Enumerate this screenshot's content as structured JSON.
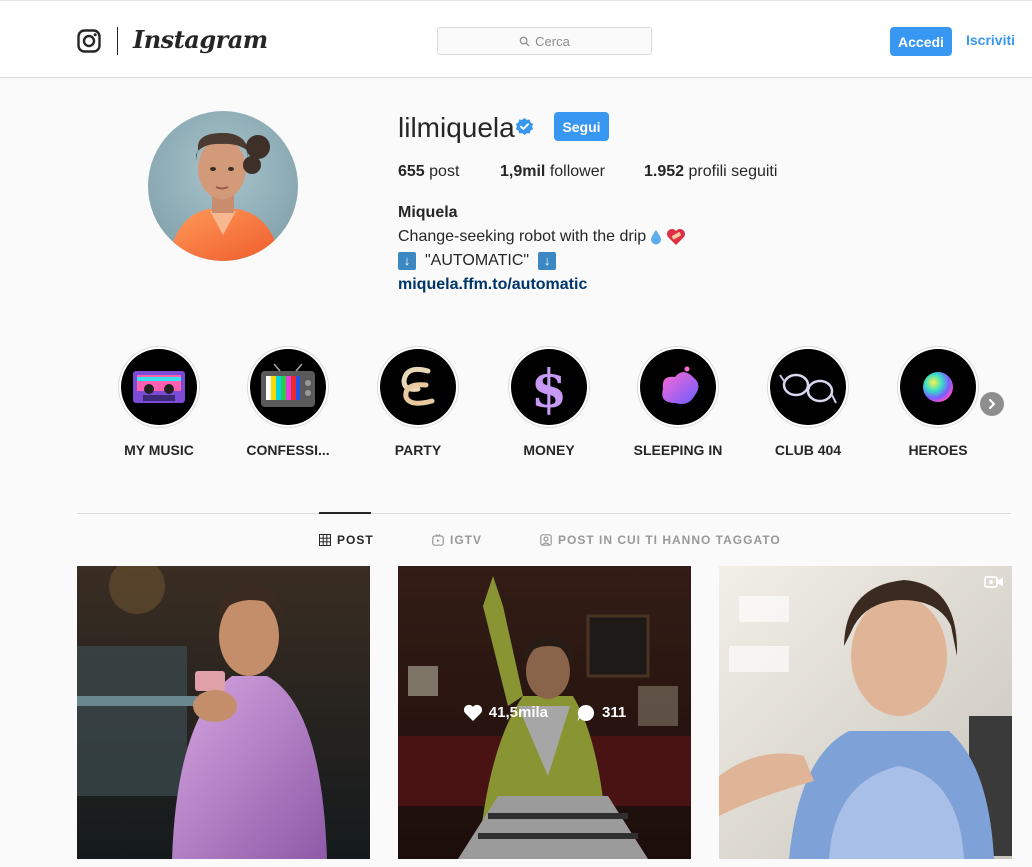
{
  "nav": {
    "brand": "Instagram",
    "search_placeholder": "Cerca",
    "login_label": "Accedi",
    "signup_label": "Iscriviti"
  },
  "profile": {
    "username": "lilmiquela",
    "follow_label": "Segui",
    "stats": [
      {
        "value": "655",
        "label": "post"
      },
      {
        "value": "1,9mil",
        "label": "follower"
      },
      {
        "value": "1.952",
        "label": "profili seguiti"
      }
    ],
    "full_name": "Miquela",
    "bio_line1": "Change-seeking robot with the drip",
    "bio_line2": "\"AUTOMATIC\"",
    "link": "miquela.ffm.to/automatic"
  },
  "highlights": [
    {
      "label": "MY MUSIC",
      "icon": "cassette-icon"
    },
    {
      "label": "CONFESSI...",
      "icon": "tv-icon"
    },
    {
      "label": "PARTY",
      "icon": "cl-logo-icon"
    },
    {
      "label": "MONEY",
      "icon": "dollar-icon"
    },
    {
      "label": "SLEEPING IN",
      "icon": "blob-icon"
    },
    {
      "label": "CLUB 404",
      "icon": "glasses-icon"
    },
    {
      "label": "HEROES",
      "icon": "orb-icon"
    }
  ],
  "tabs": [
    {
      "label": "POST",
      "icon": "grid-icon",
      "active": true
    },
    {
      "label": "IGTV",
      "icon": "igtv-icon",
      "active": false
    },
    {
      "label": "POST IN CUI TI HANNO TAGGATO",
      "icon": "tagged-icon",
      "active": false
    }
  ],
  "posts": [
    {
      "type": "photo"
    },
    {
      "type": "photo",
      "likes": "41,5mila",
      "comments": "311"
    },
    {
      "type": "video"
    }
  ],
  "colors": {
    "accent": "#3897f0",
    "link": "#003569",
    "border": "#dbdbdb",
    "background": "#fafafa"
  }
}
